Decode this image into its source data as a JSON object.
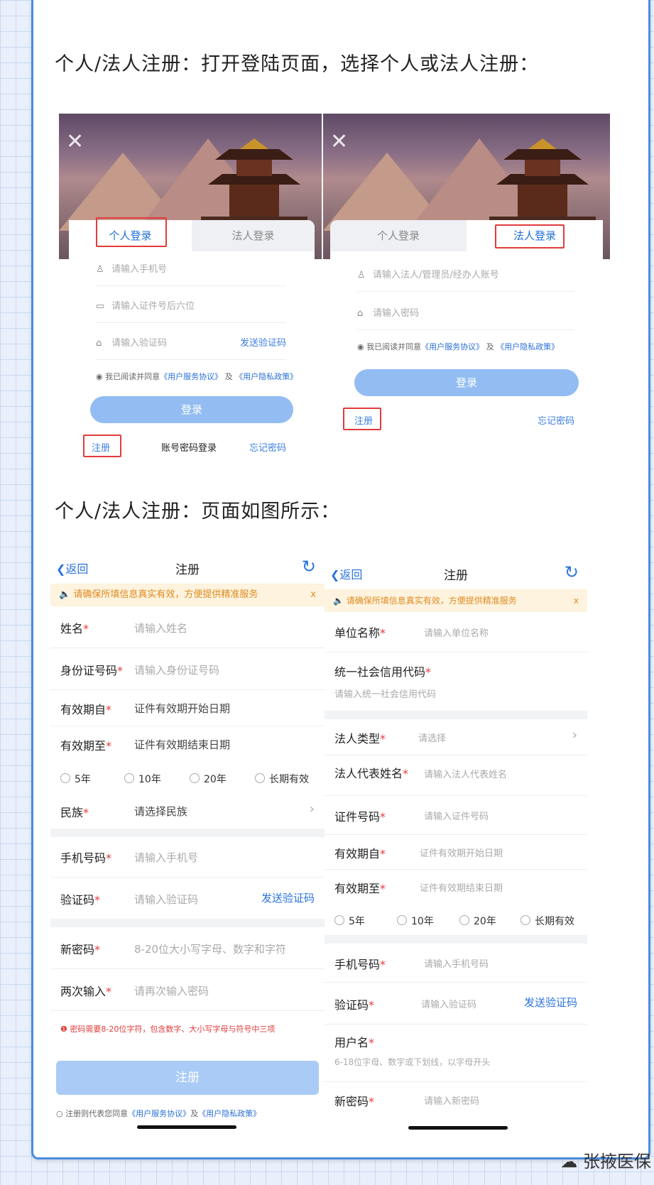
{
  "headings": {
    "h1": "个人/法人注册：打开登陆页面，选择个人或法人注册：",
    "h2": "个人/法人注册：页面如图所示："
  },
  "login_personal": {
    "tab_active": "个人登录",
    "tab_inactive": "法人登录",
    "phone_ph": "请输入手机号",
    "id_ph": "请输入证件号后六位",
    "code_ph": "请输入验证码",
    "send_code": "发送验证码",
    "agree_prefix": "我已阅读并同意",
    "agree_link1": "《用户服务协议》",
    "agree_and": "及",
    "agree_link2": "《用户隐私政策》",
    "login_btn": "登录",
    "register": "注册",
    "pwd_login": "账号密码登录",
    "forgot": "忘记密码"
  },
  "login_legal": {
    "tab_inactive": "个人登录",
    "tab_active": "法人登录",
    "account_ph": "请输入法人/管理员/经办人账号",
    "pwd_ph": "请输入密码",
    "agree_prefix": "我已阅读并同意",
    "agree_link1": "《用户服务协议》",
    "agree_and": "及",
    "agree_link2": "《用户隐私政策》",
    "login_btn": "登录",
    "register": "注册",
    "forgot": "忘记密码"
  },
  "reg_personal": {
    "back": "返回",
    "title": "注册",
    "notice": "请确保所填信息真实有效，方便提供精准服务",
    "notice_close": "x",
    "name_label": "姓名",
    "name_ph": "请输入姓名",
    "idno_label": "身份证号码",
    "idno_ph": "请输入身份证号码",
    "from_label": "有效期自",
    "from_ph": "证件有效期开始日期",
    "to_label": "有效期至",
    "to_ph": "证件有效期结束日期",
    "r1": "5年",
    "r2": "10年",
    "r3": "20年",
    "r4": "长期有效",
    "nation_label": "民族",
    "nation_ph": "请选择民族",
    "phone_label": "手机号码",
    "phone_ph": "请输入手机号",
    "code_label": "验证码",
    "code_ph": "请输入验证码",
    "send_code": "发送验证码",
    "newpwd_label": "新密码",
    "newpwd_ph": "8-20位大小写字母、数字和字符",
    "again_label": "两次输入",
    "again_ph": "请再次输入密码",
    "warn": "密码需要8-20位字符，包含数字、大小写字母与符号中三项",
    "reg_btn": "注册",
    "foot_prefix": "注册则代表您同意",
    "foot_link1": "《用户服务协议》",
    "foot_and": "及",
    "foot_link2": "《用户隐私政策》"
  },
  "reg_legal": {
    "back": "返回",
    "title": "注册",
    "notice": "请确保所填信息真实有效，方便提供精准服务",
    "notice_close": "x",
    "unit_label": "单位名称",
    "unit_ph": "请输入单位名称",
    "credit_label": "统一社会信用代码",
    "credit_ph": "请输入统一社会信用代码",
    "type_label": "法人类型",
    "type_ph": "请选择",
    "rep_label": "法人代表姓名",
    "rep_ph": "请输入法人代表姓名",
    "cert_label": "证件号码",
    "cert_ph": "请输入证件号码",
    "from_label": "有效期自",
    "from_ph": "证件有效期开始日期",
    "to_label": "有效期至",
    "to_ph": "证件有效期结束日期",
    "r1": "5年",
    "r2": "10年",
    "r3": "20年",
    "r4": "长期有效",
    "phone_label": "手机号码",
    "phone_ph": "请输入手机号码",
    "code_label": "验证码",
    "code_ph": "请输入验证码",
    "send_code": "发送验证码",
    "user_label": "用户名",
    "user_ph": "6-18位字母、数字或下划线，以字母开头",
    "newpwd_label": "新密码",
    "newpwd_ph": "请输入新密码"
  },
  "watermark": "张掖医保",
  "colors": {
    "accent": "#2a73de",
    "required": "#e23b3b",
    "notice_bg": "#fdf3de",
    "highlight_box": "#e23b3b"
  }
}
